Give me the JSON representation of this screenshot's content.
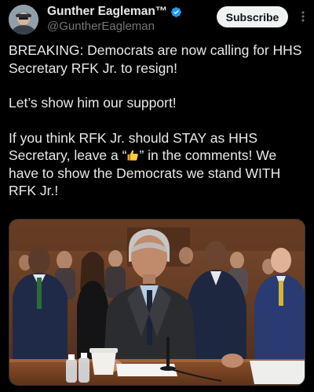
{
  "header": {
    "display_name": "Gunther Eagleman™",
    "handle": "@GuntherEagleman",
    "subscribe_label": "Subscribe"
  },
  "tweet": {
    "paragraph_1": "BREAKING: Democrats are now calling for HHS Secretary RFK Jr. to resign!",
    "paragraph_2": "Let’s show him our support!",
    "paragraph_3_pre": "If you think RFK Jr. should STAY as HHS Secretary, leave a “",
    "paragraph_3_emoji": "thumbs-up-emoji",
    "paragraph_3_post": "” in the comments! We have to show the Democrats we stand WITH RFK Jr.!"
  },
  "media": {
    "description_icon": "photo-of-man-seated-at-hearing-table"
  },
  "colors": {
    "background": "#000000",
    "text": "#e7e9ea",
    "muted": "#71767b",
    "verified": "#1d9bf0",
    "button_bg": "#eff3f4",
    "button_text": "#0f1419"
  }
}
